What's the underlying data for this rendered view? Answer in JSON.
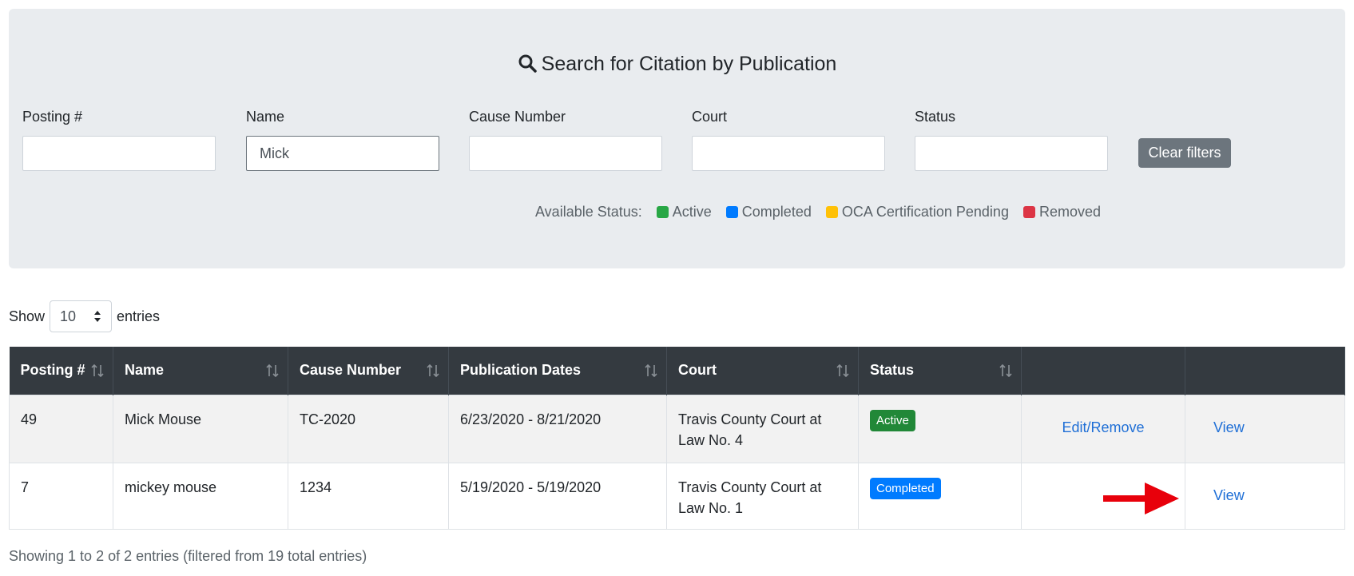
{
  "search": {
    "title": "Search for Citation by Publication",
    "filters": [
      {
        "label": "Posting #",
        "value": "",
        "placeholder": ""
      },
      {
        "label": "Name",
        "value": "Mick",
        "placeholder": ""
      },
      {
        "label": "Cause Number",
        "value": "",
        "placeholder": ""
      },
      {
        "label": "Court",
        "value": "",
        "placeholder": ""
      },
      {
        "label": "Status",
        "value": "",
        "placeholder": ""
      }
    ],
    "clear_label": "Clear filters",
    "legend": {
      "label": "Available Status:",
      "items": [
        {
          "label": "Active",
          "color": "#28a745"
        },
        {
          "label": "Completed",
          "color": "#007bff"
        },
        {
          "label": "OCA Certification Pending",
          "color": "#ffc107"
        },
        {
          "label": "Removed",
          "color": "#dc3545"
        }
      ]
    }
  },
  "length": {
    "show": "Show",
    "value": "10",
    "entries": "entries"
  },
  "table": {
    "headers": [
      "Posting #",
      "Name",
      "Cause Number",
      "Publication Dates",
      "Court",
      "Status",
      "",
      ""
    ],
    "rows": [
      {
        "posting": "49",
        "name": "Mick Mouse",
        "cause": "TC-2020",
        "dates": "6/23/2020 - 8/21/2020",
        "court_line1": "Travis County Court at",
        "court_line2": "Law No. 4",
        "status": "Active",
        "status_color": "#218838",
        "edit": "Edit/Remove",
        "view": "View"
      },
      {
        "posting": "7",
        "name": "mickey mouse",
        "cause": "1234",
        "dates": "5/19/2020 - 5/19/2020",
        "court_line1": "Travis County Court at",
        "court_line2": "Law No. 1",
        "status": "Completed",
        "status_color": "#007bff",
        "edit": "",
        "view": "View"
      }
    ]
  },
  "info": "Showing 1 to 2 of 2 entries (filtered from 19 total entries)",
  "colors": {
    "accent": "#1f6fd6",
    "header_bg": "#343a40",
    "panel_bg": "#e9ecef",
    "arrow": "#e8000b"
  }
}
